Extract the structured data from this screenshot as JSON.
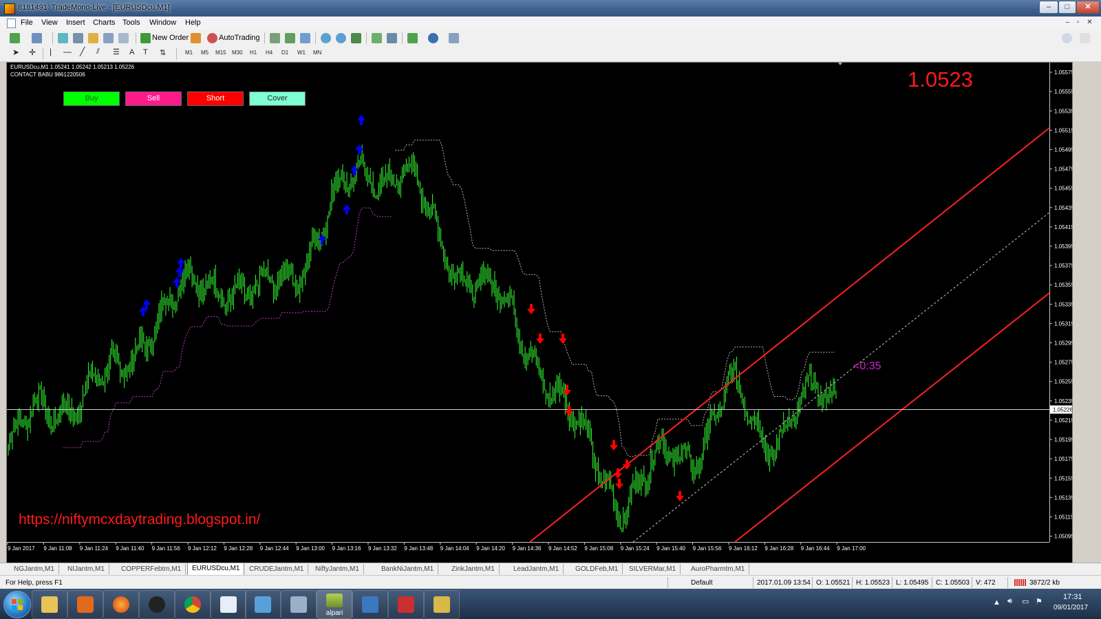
{
  "window": {
    "title": "8181491: TradeMono-Live - [EURUSDcu,M1]",
    "min": "–",
    "max": "□",
    "close": "✕"
  },
  "menu": [
    "File",
    "View",
    "Insert",
    "Charts",
    "Tools",
    "Window",
    "Help"
  ],
  "toolbar": {
    "new_order": "New Order",
    "autotrading": "AutoTrading",
    "timeframes": [
      "M1",
      "M5",
      "M15",
      "M30",
      "H1",
      "H4",
      "D1",
      "W1",
      "MN"
    ]
  },
  "chart": {
    "symbol_line": "EURUSDcu,M1  1.05241 1.05242 1.05213 1.05226",
    "contact_line": "CONTACT BABU 9861220506",
    "buttons": [
      {
        "label": "Buy",
        "color": "#00ff00"
      },
      {
        "label": "Sell",
        "color": "#ff1a8c"
      },
      {
        "label": "Short",
        "color": "#ff0000"
      },
      {
        "label": "Cover",
        "color": "#7fffd4"
      }
    ],
    "big_price": "1.0523",
    "countdown": "<0:35",
    "url": "https://niftymcxdaytrading.blogspot.in/",
    "current_price_label": "1.05226",
    "colors": {
      "candles": "#33ff33",
      "buy_arrow": "#0000ff",
      "sell_arrow": "#ff0000",
      "channel": "#ff2222",
      "stop_dots": "#c040c0",
      "grid_dots": "#cccccc"
    }
  },
  "chart_data": {
    "type": "line",
    "title": "EURUSDcu,M1",
    "ylim": [
      1.05089,
      1.05585
    ],
    "y_ticks": [
      "1.05575",
      "1.05555",
      "1.05535",
      "1.05515",
      "1.05495",
      "1.05475",
      "1.05455",
      "1.05435",
      "1.05415",
      "1.05395",
      "1.05375",
      "1.05355",
      "1.05335",
      "1.05315",
      "1.05295",
      "1.05275",
      "1.05255",
      "1.05235",
      "1.05215",
      "1.05195",
      "1.05175",
      "1.05155",
      "1.05135",
      "1.05115",
      "1.05095"
    ],
    "x_ticks": [
      "9 Jan 2017",
      "9 Jan 11:08",
      "9 Jan 11:24",
      "9 Jan 11:40",
      "9 Jan 11:56",
      "9 Jan 12:12",
      "9 Jan 12:28",
      "9 Jan 12:44",
      "9 Jan 13:00",
      "9 Jan 13:16",
      "9 Jan 13:32",
      "9 Jan 13:48",
      "9 Jan 14:04",
      "9 Jan 14:20",
      "9 Jan 14:36",
      "9 Jan 14:52",
      "9 Jan 15:08",
      "9 Jan 15:24",
      "9 Jan 15:40",
      "9 Jan 15:56",
      "9 Jan 16:12",
      "9 Jan 16:28",
      "9 Jan 16:44",
      "9 Jan 17:00"
    ],
    "series": [
      {
        "name": "EURUSDcu,M1",
        "x": [
          "9 Jan 2017",
          "9 Jan 11:08",
          "9 Jan 11:24",
          "9 Jan 11:40",
          "9 Jan 11:56",
          "9 Jan 12:12",
          "9 Jan 12:28",
          "9 Jan 12:44",
          "9 Jan 13:00",
          "9 Jan 13:16",
          "9 Jan 13:32",
          "9 Jan 13:48",
          "9 Jan 14:04",
          "9 Jan 14:20",
          "9 Jan 14:36",
          "9 Jan 14:52",
          "9 Jan 15:08",
          "9 Jan 15:24",
          "9 Jan 15:40",
          "9 Jan 15:56",
          "9 Jan 16:12",
          "9 Jan 16:28",
          "9 Jan 16:44",
          "9 Jan 17:00"
        ],
        "values": [
          1.05185,
          1.05225,
          1.05245,
          1.05255,
          1.05325,
          1.05345,
          1.05365,
          1.05335,
          1.05375,
          1.05435,
          1.05475,
          1.05475,
          1.05395,
          1.05365,
          1.05315,
          1.05265,
          1.05185,
          1.05135,
          1.05165,
          1.05185,
          1.05245,
          1.05195,
          1.05235,
          1.05226
        ]
      }
    ],
    "horizontal_line": 1.05226,
    "grid": false
  },
  "tabs": [
    {
      "label": "NGJantm,M1",
      "active": false
    },
    {
      "label": "NIJantm,M1",
      "active": false
    },
    {
      "label": "COPPERFebtm,M1",
      "active": false
    },
    {
      "label": "EURUSDcu,M1",
      "active": true
    },
    {
      "label": "CRUDEJantm,M1",
      "active": false
    },
    {
      "label": "NiftyJantm,M1",
      "active": false
    },
    {
      "label": "BankNiJantm,M1",
      "active": false
    },
    {
      "label": "ZinkJantm,M1",
      "active": false
    },
    {
      "label": "LeadJantm,M1",
      "active": false
    },
    {
      "label": "GOLDFeb,M1",
      "active": false
    },
    {
      "label": "SILVERMar,M1",
      "active": false
    },
    {
      "label": "AuroPharmtm,M1",
      "active": false
    }
  ],
  "status": {
    "help": "For Help, press F1",
    "profile": "Default",
    "datetime": "2017.01.09 13:54",
    "open": "O: 1.05521",
    "high": "H: 1.05523",
    "low": "L: 1.05495",
    "close": "C: 1.05503",
    "volume": "V: 472",
    "traffic": "3872/2 kb"
  },
  "taskbar": {
    "alpari_label": "alpari",
    "time": "17:31",
    "date": "09/01/2017"
  }
}
